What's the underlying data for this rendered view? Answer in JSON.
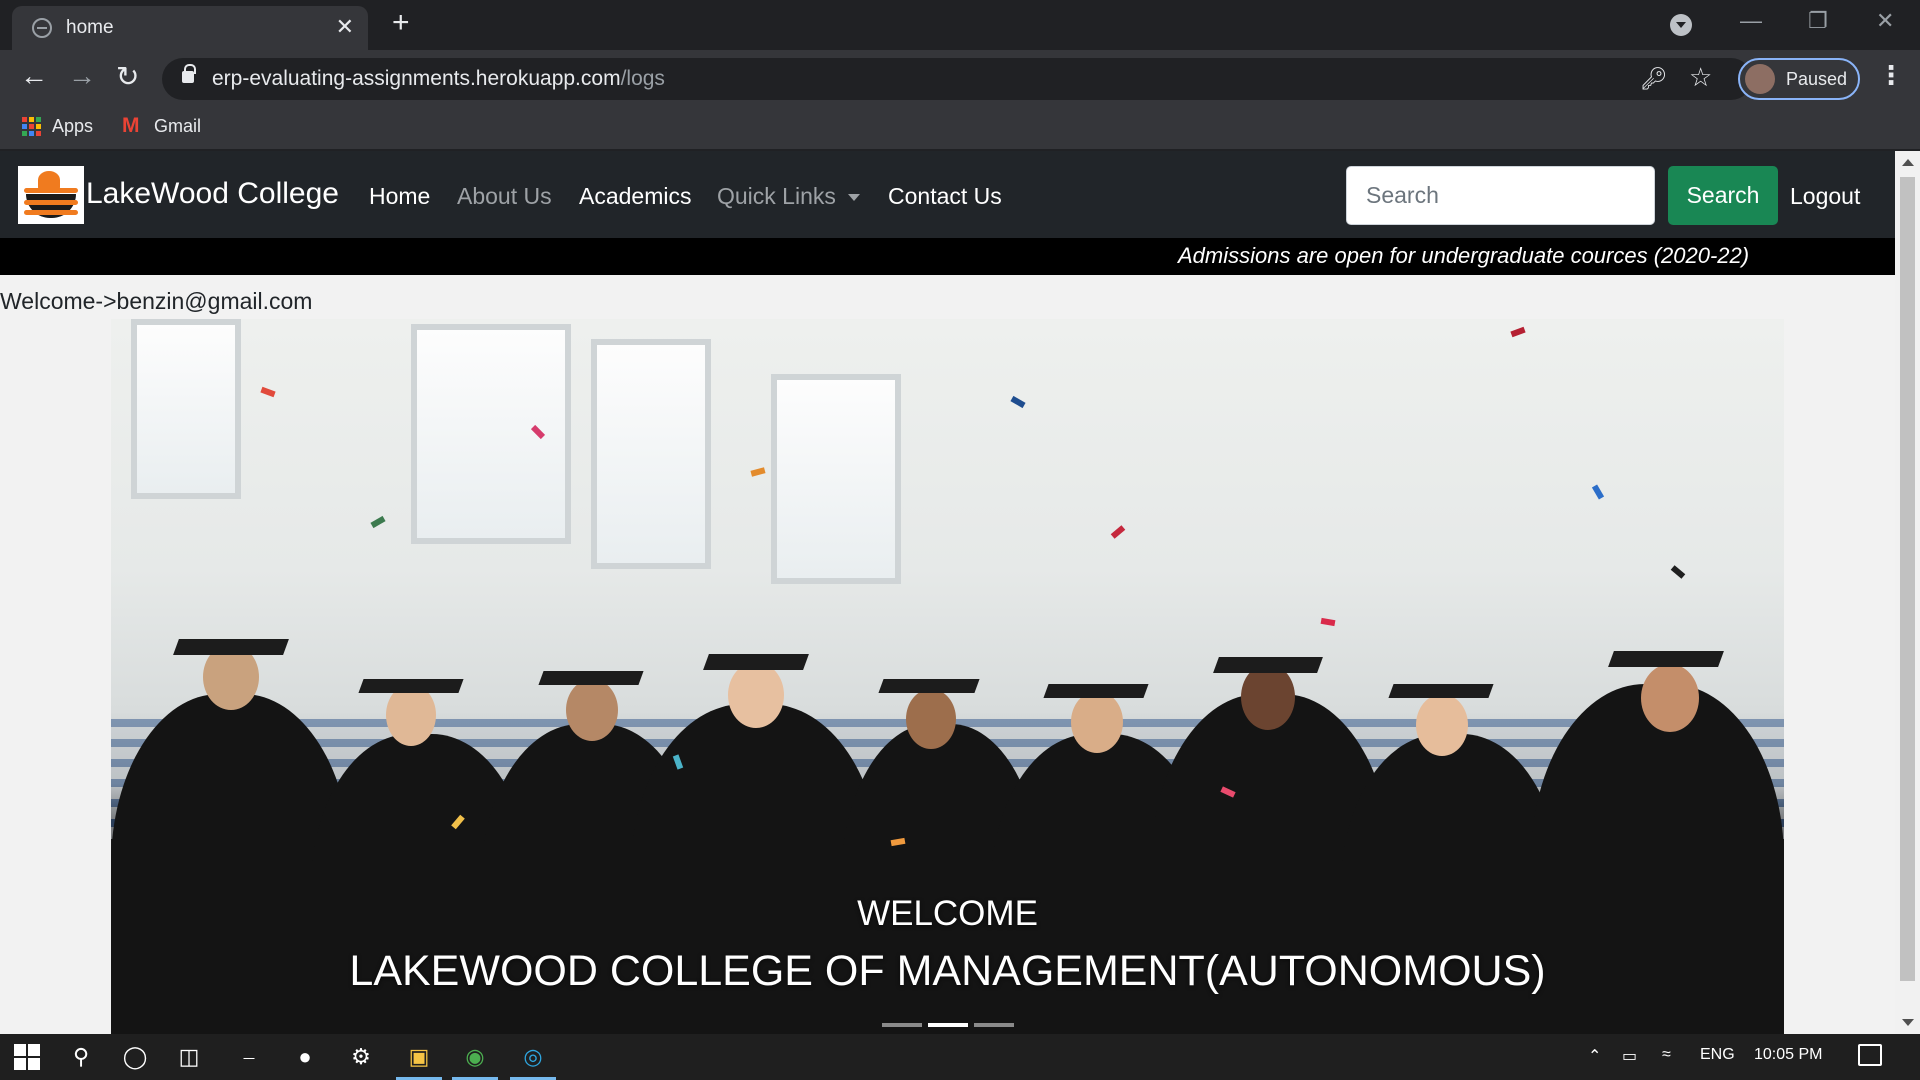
{
  "browser": {
    "tab_title": "home",
    "tab_close": "✕",
    "new_tab": "+",
    "url_host": "erp-evaluating-assignments.herokuapp.com",
    "url_path": "/logs",
    "profile_label": "Paused",
    "bookmarks": [
      {
        "label": "Apps",
        "icon": "apps-grid-icon"
      },
      {
        "label": "Gmail",
        "icon": "gmail-icon"
      }
    ]
  },
  "navbar": {
    "brand": "LakeWood College",
    "links": [
      {
        "label": "Home",
        "active": true
      },
      {
        "label": "About Us",
        "active": false
      },
      {
        "label": "Academics",
        "active": true
      },
      {
        "label": "Quick Links",
        "active": false,
        "dropdown": true
      },
      {
        "label": "Contact Us",
        "active": true
      }
    ],
    "search_placeholder": "Search",
    "search_button": "Search",
    "logout": "Logout"
  },
  "marquee": "Admissions are open for undergraduate cources (2020-22)",
  "welcome": "Welcome->benzin@gmail.com",
  "carousel": {
    "caption_small": "WELCOME",
    "caption_large": "LAKEWOOD COLLEGE OF MANAGEMENT(AUTONOMOUS)",
    "slides": 3,
    "active_slide": 1
  },
  "taskbar": {
    "language": "ENG",
    "time": "10:05 PM"
  },
  "colors": {
    "navbar_bg": "#212529",
    "search_button_bg": "#198754",
    "marquee_bg": "#000000",
    "page_bg": "#f2f2f2",
    "logo_accent": "#f07b1f"
  }
}
